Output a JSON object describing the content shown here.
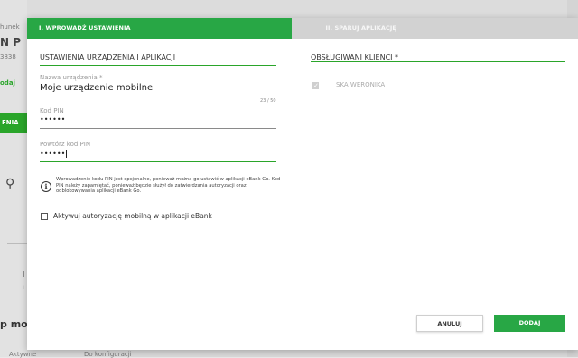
{
  "background": {
    "texts": [
      "hunek",
      "N P",
      "3838",
      "odaj",
      "ENIA",
      "I",
      "L",
      "p mo",
      "Aktywne",
      "Do konfiguracji"
    ]
  },
  "stepper": {
    "step1": "I. WPROWADŹ USTAWIENIA",
    "step2": "II. SPARUJ APLIKACJĘ"
  },
  "left_section": {
    "title": "USTAWIENIA URZĄDZENIA I APLIKACJI",
    "device_name_label": "Nazwa urządzenia *",
    "device_name_value": "Moje urządzenie mobilne",
    "device_name_counter": "23 / 50",
    "pin_label": "Kod PIN",
    "pin_value": "••••••",
    "repeat_pin_label": "Powtórz kod PIN",
    "repeat_pin_value": "••••••",
    "info_text": "Wprowadzenie kodu PIN jest opcjonalne, ponieważ można go ustawić w aplikacji eBank Go. Kod PIN należy zapamiętać, ponieważ będzie służył do zatwierdzania autoryzacji oraz odblokowywania aplikacji eBank Go.",
    "checkbox_label": "Aktywuj autoryzację mobilną w aplikacji eBank"
  },
  "right_section": {
    "title": "OBSŁUGIWANI KLIENCI *",
    "client_label": "SKA WERONIKA"
  },
  "buttons": {
    "cancel": "ANULUJ",
    "add": "DODAJ"
  },
  "colors": {
    "accent": "#28a745"
  }
}
